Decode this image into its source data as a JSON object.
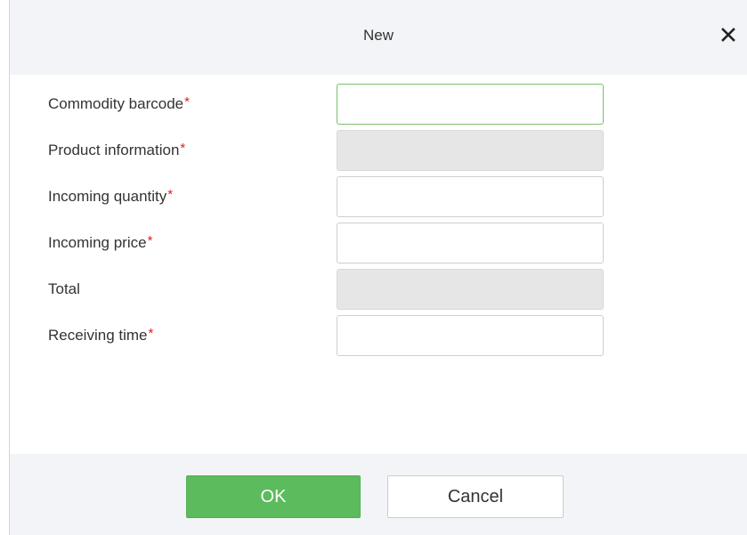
{
  "dialog": {
    "title": "New",
    "close_icon": "close-icon"
  },
  "form": {
    "required_marker": "*",
    "fields": [
      {
        "label": "Commodity barcode",
        "required": true,
        "value": "",
        "state": "focused"
      },
      {
        "label": "Product information",
        "required": true,
        "value": "",
        "state": "disabled"
      },
      {
        "label": "Incoming quantity",
        "required": true,
        "value": "",
        "state": "normal"
      },
      {
        "label": "Incoming price",
        "required": true,
        "value": "",
        "state": "normal"
      },
      {
        "label": "Total",
        "required": false,
        "value": "",
        "state": "disabled"
      },
      {
        "label": "Receiving time",
        "required": true,
        "value": "",
        "state": "normal"
      }
    ]
  },
  "footer": {
    "ok_label": "OK",
    "cancel_label": "Cancel"
  },
  "colors": {
    "ok_button": "#5cbb5c",
    "required_marker": "#e02020",
    "focus_border": "#7bbf6a",
    "disabled_field": "#e6e6e6",
    "header_footer_bg": "#f3f4f8"
  }
}
